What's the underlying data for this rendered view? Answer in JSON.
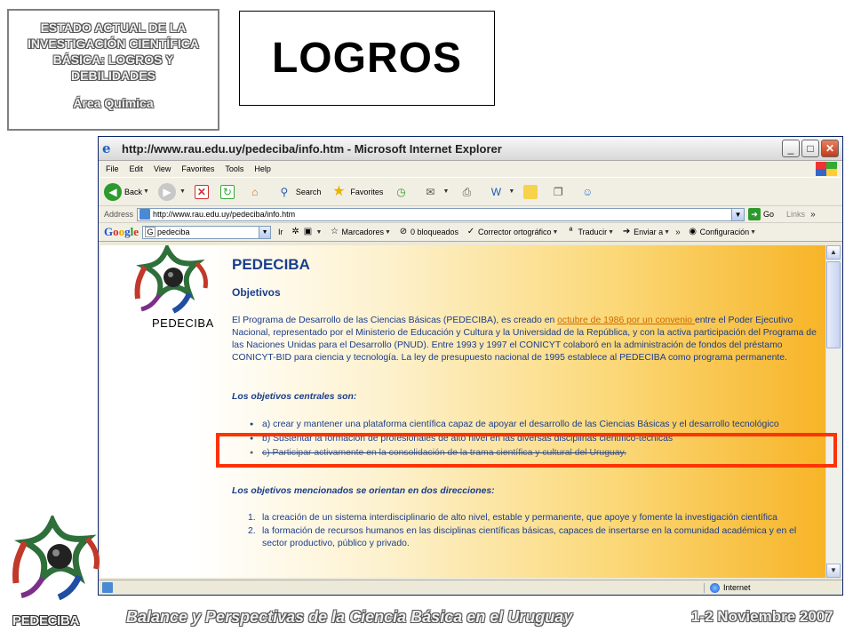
{
  "slide": {
    "title_lines": [
      "ESTADO ACTUAL DE LA",
      "INVESTIGACIÓN CIENTÍFICA",
      "BÁSICA: LOGROS Y",
      "DEBILIDADES"
    ],
    "area": "Área Química",
    "heading": "LOGROS",
    "footer_text": "Balance y Perspectivas de la Ciencia Básica en el Uruguay",
    "footer_date": "1-2 Noviembre 2007",
    "footer_logo_text": "PEDECIBA"
  },
  "window": {
    "title": "http://www.rau.edu.uy/pedeciba/info.htm - Microsoft Internet Explorer",
    "controls": {
      "minimize": "_",
      "maximize": "□",
      "close": "✕"
    }
  },
  "menu": [
    "File",
    "Edit",
    "View",
    "Favorites",
    "Tools",
    "Help"
  ],
  "toolbar": {
    "back_label": "Back",
    "search_label": "Search",
    "favorites_label": "Favorites"
  },
  "address": {
    "label": "Address",
    "value": "http://www.rau.edu.uy/pedeciba/info.htm",
    "go_label": "Go",
    "links_label": "Links"
  },
  "google_bar": {
    "logo_letters": [
      "G",
      "o",
      "o",
      "g",
      "l",
      "e"
    ],
    "search_value": "pedeciba",
    "truncated": "Ir",
    "marcadores": "Marcadores",
    "bloqueados": "0 bloqueados",
    "corrector": "Corrector ortográfico",
    "traducir": "Traducir",
    "enviar": "Enviar a",
    "configuracion": "Configuración"
  },
  "page": {
    "logo_text": "PEDECIBA",
    "h1": "PEDECIBA",
    "h2": "Objetivos",
    "para_before": "El Programa de Desarrollo de las Ciencias Básicas (PEDECIBA), es creado en ",
    "para_link": "octubre de 1986 por un convenio ",
    "para_after": "entre el Poder Ejecutivo Nacional, representado por el Ministerio de Educación y Cultura y la Universidad de la República, y con la activa participación del Programa de las Naciones Unidas para el Desarrollo (PNUD). Entre 1993 y 1997 el CONICYT colaboró en la administración de fondos del préstamo CONICYT-BID para ciencia y tecnología. La ley de presupuesto nacional de 1995 establece al PEDECIBA como programa permanente.",
    "objectives_heading": "Los objetivos centrales son:",
    "objectives": [
      "a) crear y mantener una plataforma científica capaz de apoyar el desarrollo de las Ciencias Básicas y el desarrollo tecnológico",
      "b) Sustentar la formación de profesionales de alto nivel en las diversas disciplinas científico-técnicas",
      "c) Participar activamente en la consolidación de la trama científica y cultural del Uruguay."
    ],
    "directions_heading": "Los objetivos mencionados se orientan en dos direcciones:",
    "directions": [
      {
        "num": "1.",
        "text": "la creación de un sistema interdisciplinario de alto nivel, estable y permanente, que apoye y fomente la investigación científica"
      },
      {
        "num": "2.",
        "text": "la formación de recursos humanos en las disciplinas científicas básicas, capaces de insertarse en la comunidad académica y en el sector productivo, público y privado."
      }
    ]
  },
  "status": {
    "zone": "Internet"
  },
  "colors": {
    "highlight": "#ff3300",
    "page_text": "#1a3d8c",
    "link": "#cc6a00"
  }
}
